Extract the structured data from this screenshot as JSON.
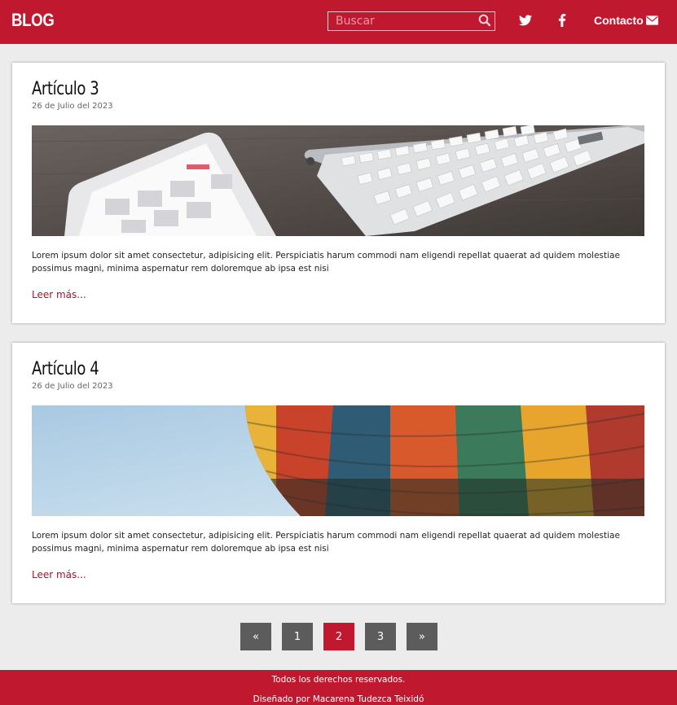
{
  "header": {
    "logo": "BLOG",
    "search_placeholder": "Buscar",
    "contact_label": "Contacto"
  },
  "articles": [
    {
      "title": "Artículo 3",
      "date": "26 de Julio del 2023",
      "image": "tablet-calendar-and-keyboard-photo",
      "text": "Lorem ipsum dolor sit amet consectetur, adipisicing elit. Perspiciatis harum commodi nam eligendi repellat quaerat ad quidem molestiae possimus magni, minima aspernatur rem doloremque ab ipsa est nisi",
      "link": "Leer más..."
    },
    {
      "title": "Artículo 4",
      "date": "26 de Julio del 2023",
      "image": "hot-air-balloon-photo",
      "text": "Lorem ipsum dolor sit amet consectetur, adipisicing elit. Perspiciatis harum commodi nam eligendi repellat quaerat ad quidem molestiae possimus magni, minima aspernatur rem doloremque ab ipsa est nisi",
      "link": "Leer más..."
    }
  ],
  "pagination": {
    "prev": "«",
    "pages": [
      "1",
      "2",
      "3"
    ],
    "current": "2",
    "next": "»"
  },
  "footer": {
    "line1": "Todos los derechos reservados.",
    "line2": "Diseñado por Macarena Tudezca Teixidó"
  },
  "colors": {
    "brand": "#c0192f",
    "page_bg": "#ececec",
    "pagination_bg": "#5c5c5c"
  }
}
